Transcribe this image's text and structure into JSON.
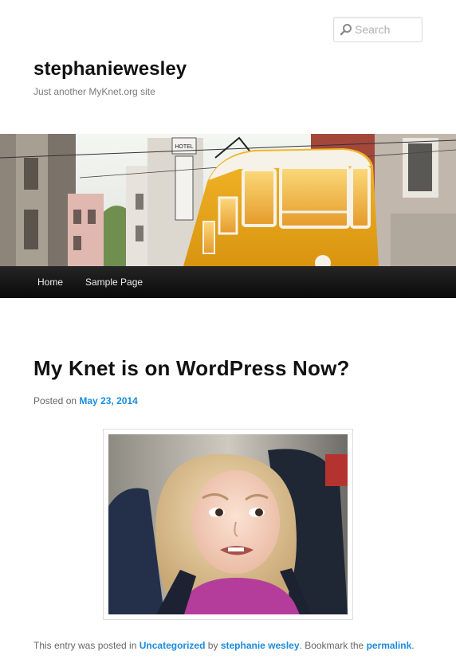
{
  "search": {
    "placeholder": "Search",
    "icon": "search-icon"
  },
  "site": {
    "title": "stephaniewesley",
    "description": "Just another MyKnet.org site"
  },
  "header_image": {
    "alt": "Yellow tram on a city street",
    "sign_text": "HOTEL BUIGO ATLANTICO"
  },
  "nav": {
    "items": [
      {
        "label": "Home"
      },
      {
        "label": "Sample Page"
      }
    ]
  },
  "post": {
    "title": "My Knet is on WordPress Now?",
    "posted_on_prefix": "Posted on",
    "date": "May 23, 2014",
    "image_alt": "Young girl making a side-eye face",
    "footer": {
      "prefix": "This entry was posted in",
      "category": "Uncategorized",
      "by": "by",
      "author": "stephanie wesley",
      "bookmark": ". Bookmark the",
      "permalink": "permalink",
      "end": "."
    }
  },
  "colors": {
    "link": "#1b8be0",
    "nav_bg": "#111111",
    "title": "#111111"
  }
}
